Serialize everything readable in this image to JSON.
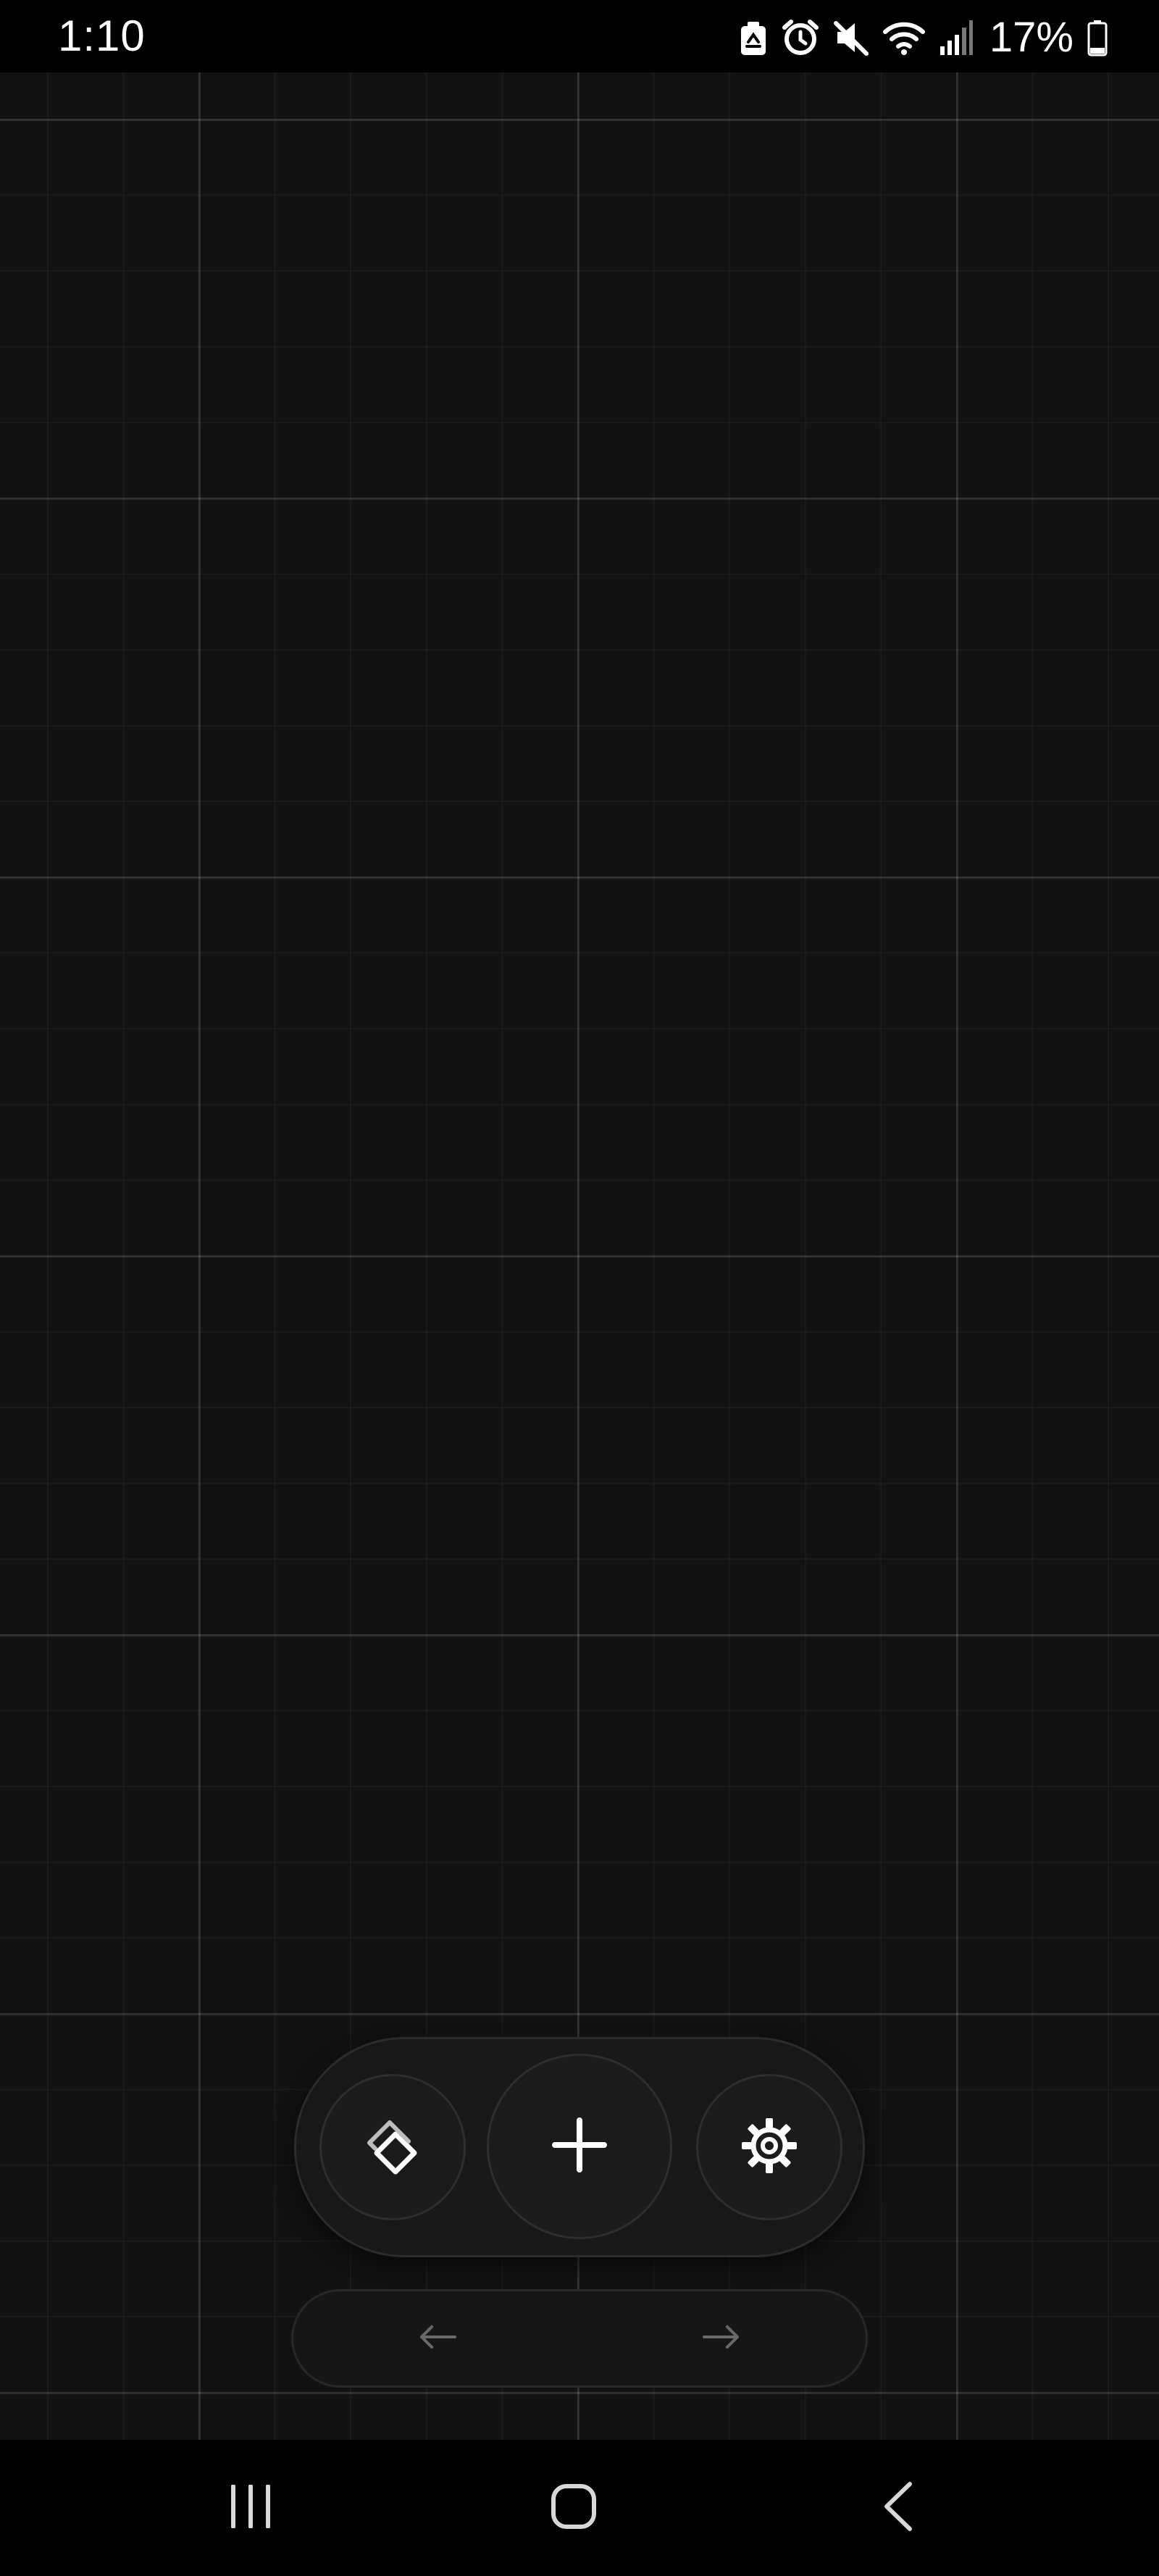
{
  "status_bar": {
    "time": "1:10",
    "battery_percent": "17%",
    "icons": [
      "recycle-notification-icon",
      "alarm-icon",
      "mute-icon",
      "wifi-icon",
      "signal-icon",
      "battery-icon"
    ]
  },
  "canvas": {
    "background_color": "#121212",
    "grid": true
  },
  "toolbar": {
    "buttons": [
      {
        "icon": "layers-icon"
      },
      {
        "icon": "plus-icon"
      },
      {
        "icon": "settings-gear-icon"
      }
    ]
  },
  "history": {
    "undo_icon": "arrow-left-icon",
    "redo_icon": "arrow-right-icon"
  },
  "nav_bar": {
    "buttons": [
      "recents-icon",
      "home-icon",
      "back-icon"
    ]
  },
  "colors": {
    "background": "#121212",
    "surface": "#181818",
    "border": "#2c2c2c",
    "icon": "#ffffff",
    "icon_muted": "#6a6a6a"
  }
}
